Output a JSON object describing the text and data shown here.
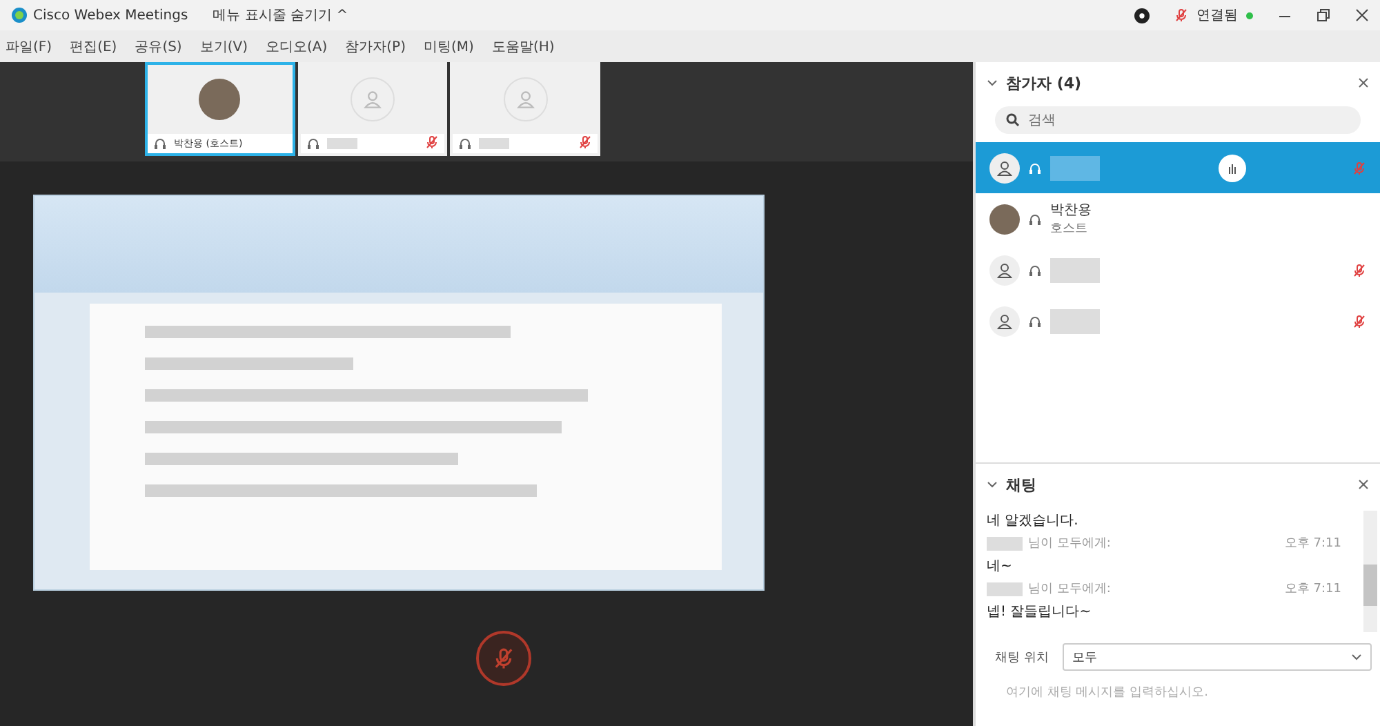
{
  "window": {
    "title": "Cisco Webex Meetings",
    "menu_toggle": "메뉴 표시줄 숨기기 ^",
    "status": "연결됨"
  },
  "menu": [
    "파일(F)",
    "편집(E)",
    "공유(S)",
    "보기(V)",
    "오디오(A)",
    "참가자(P)",
    "미팅(M)",
    "도움말(H)"
  ],
  "thumbnails": [
    {
      "name": "박찬용 (호스트)",
      "selected": true,
      "muted": false,
      "kind": "photo"
    },
    {
      "selected": false,
      "muted": true,
      "kind": "generic"
    },
    {
      "selected": false,
      "muted": true,
      "kind": "generic"
    }
  ],
  "participants": {
    "title": "참가자 (4)",
    "search": {
      "placeholder": "검색"
    },
    "items": [
      {
        "selected": true,
        "muted": true,
        "kind": "generic",
        "raised_hand": true
      },
      {
        "name": "박찬용",
        "role": "호스트",
        "selected": false,
        "muted": false,
        "kind": "photo",
        "raised_hand": false
      },
      {
        "selected": false,
        "muted": true,
        "kind": "generic",
        "raised_hand": false
      },
      {
        "selected": false,
        "muted": true,
        "kind": "generic",
        "raised_hand": false
      }
    ]
  },
  "chat": {
    "title": "채팅",
    "messages": [
      {
        "kind": "text",
        "text": "네 알겠습니다."
      },
      {
        "kind": "sender",
        "text": "님이 모두에게:",
        "time": "오후 7:11"
      },
      {
        "kind": "text",
        "text": "네~"
      },
      {
        "kind": "sender",
        "text": "님이 모두에게:",
        "time": "오후 7:11"
      },
      {
        "kind": "text",
        "text": "넵! 잘들립니다~"
      }
    ],
    "to_label": "채팅 위치",
    "to_value": "모두",
    "placeholder": "여기에 채팅 메시지를 입력하십시오."
  },
  "controls": {
    "mic_muted": true
  }
}
